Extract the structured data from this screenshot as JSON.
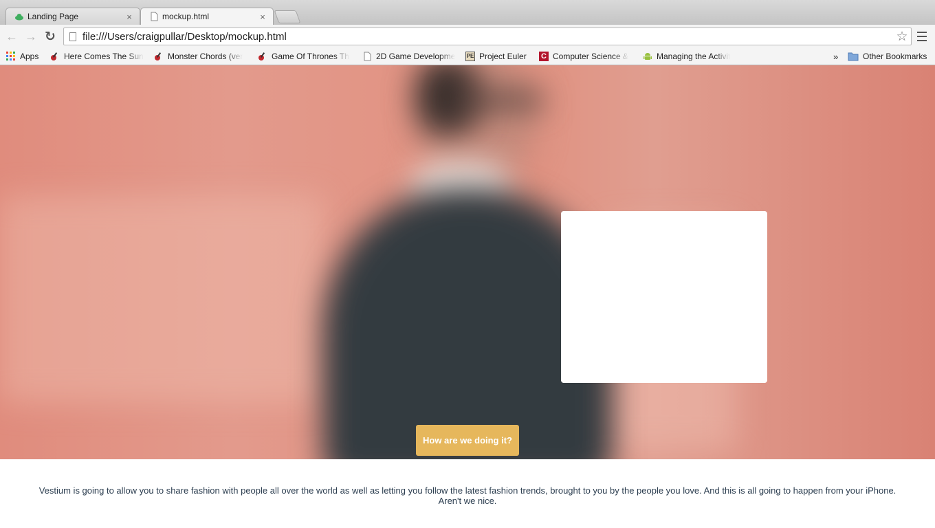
{
  "browser": {
    "tabs": [
      {
        "title": "Landing Page",
        "close": "×",
        "active": false,
        "icon": "cloud-icon"
      },
      {
        "title": "mockup.html",
        "close": "×",
        "active": true,
        "icon": "page-icon"
      }
    ],
    "url": "file:///Users/craigpullar/Desktop/mockup.html",
    "star": "☆",
    "nav": {
      "back": "←",
      "forward": "→",
      "reload": "↻"
    },
    "bookmarks": [
      {
        "label": "Apps",
        "icon": "apps-grid-icon"
      },
      {
        "label": "Here Comes The Sun",
        "icon": "guitar-icon"
      },
      {
        "label": "Monster Chords (ver",
        "icon": "guitar-icon"
      },
      {
        "label": "Game Of Thrones Th",
        "icon": "guitar-icon"
      },
      {
        "label": "2D Game Developme",
        "icon": "page-icon"
      },
      {
        "label": "Project Euler",
        "icon": "project-euler-icon"
      },
      {
        "label": "Computer Science &",
        "icon": "cs-logo-icon"
      },
      {
        "label": "Managing the Activit",
        "icon": "android-icon"
      }
    ],
    "overflow": "»",
    "other_bookmarks": "Other Bookmarks"
  },
  "page": {
    "cta_label": "How are we doing it?",
    "description_line1": "Vestium is going to allow you to share fashion with people all over the world as well as letting you follow the latest fashion trends, brought to you by the people you love. And this is all going to happen from your iPhone.",
    "description_line2": "Aren't we nice.",
    "colors": {
      "cta": "#e6b75c",
      "hero": "#e08c7d",
      "card": "#ffffff",
      "text": "#2c3e50"
    }
  }
}
